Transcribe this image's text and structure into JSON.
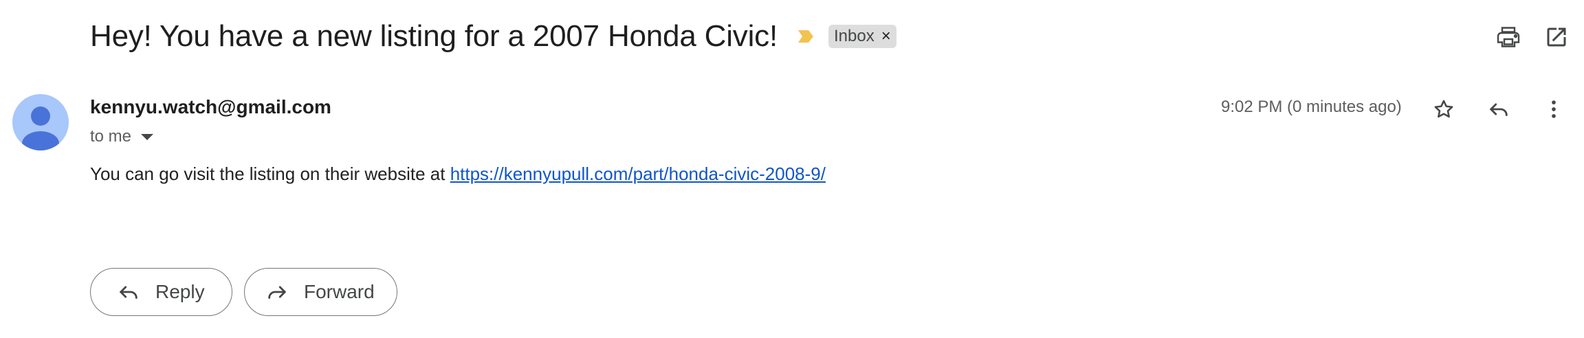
{
  "email": {
    "subject": "Hey! You have a new listing for a 2007 Honda Civic!",
    "label": {
      "text": "Inbox",
      "close_glyph": "×"
    },
    "sender": "kennyu.watch@gmail.com",
    "recipient": "to me",
    "timestamp": "9:02 PM (0 minutes ago)",
    "body_prefix": "You can go visit the listing on their website at ",
    "link": "https://kennyupull.com/part/honda-civic-2008-9/"
  },
  "actions": {
    "reply_label": "Reply",
    "forward_label": "Forward"
  },
  "icons": {
    "importance": "importance-marker-icon",
    "print": "print-icon",
    "open_new_window": "open-in-new-window-icon",
    "star": "star-icon",
    "reply": "reply-icon",
    "more": "more-vertical-icon",
    "forward": "forward-icon",
    "avatar": "default-avatar-icon"
  },
  "colors": {
    "importance": "#f2c34e",
    "label_chip_bg": "#dddddd",
    "link": "#1155cc",
    "avatar_bg": "#a8c7fa",
    "avatar_fg": "#4a73d9"
  }
}
